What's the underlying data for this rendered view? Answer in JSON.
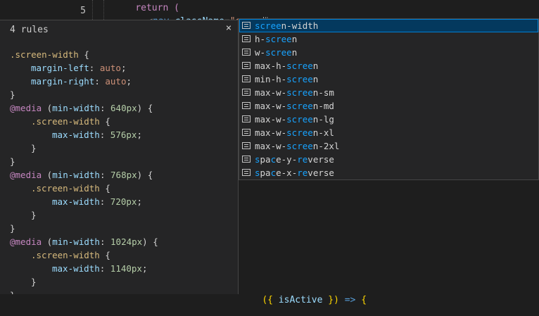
{
  "editor": {
    "line_number": "5",
    "line_prev_text": "return (",
    "tag_open": "<",
    "tag_name": "nav",
    "attr_name": "className",
    "attr_eq": "=",
    "attr_value": "\"scree",
    "tag_close": "\">",
    "bottom_code_open": "({",
    "bottom_code_var": " isActive ",
    "bottom_code_close": "})",
    "bottom_code_arrow": " => ",
    "bottom_code_brace": "{"
  },
  "hover": {
    "header": "4 rules",
    "close_symbol": "×",
    "lines": [
      {
        "type": "blank"
      },
      {
        "type": "selector",
        "indent": 0,
        "selector": ".screen-width",
        "tail": " {"
      },
      {
        "type": "decl",
        "indent": 1,
        "prop": "margin-left",
        "value": "auto"
      },
      {
        "type": "decl",
        "indent": 1,
        "prop": "margin-right",
        "value": "auto"
      },
      {
        "type": "close",
        "indent": 0
      },
      {
        "type": "media",
        "indent": 0,
        "at": "@media",
        "cond_open": " (",
        "prop": "min-width",
        "num": "640px",
        "cond_close": ") {"
      },
      {
        "type": "selector",
        "indent": 1,
        "selector": ".screen-width",
        "tail": " {"
      },
      {
        "type": "decl",
        "indent": 2,
        "prop": "max-width",
        "num": "576px"
      },
      {
        "type": "close",
        "indent": 1
      },
      {
        "type": "close",
        "indent": 0
      },
      {
        "type": "media",
        "indent": 0,
        "at": "@media",
        "cond_open": " (",
        "prop": "min-width",
        "num": "768px",
        "cond_close": ") {"
      },
      {
        "type": "selector",
        "indent": 1,
        "selector": ".screen-width",
        "tail": " {"
      },
      {
        "type": "decl",
        "indent": 2,
        "prop": "max-width",
        "num": "720px"
      },
      {
        "type": "close",
        "indent": 1
      },
      {
        "type": "close",
        "indent": 0
      },
      {
        "type": "media",
        "indent": 0,
        "at": "@media",
        "cond_open": " (",
        "prop": "min-width",
        "num": "1024px",
        "cond_close": ") {"
      },
      {
        "type": "selector",
        "indent": 1,
        "selector": ".screen-width",
        "tail": " {"
      },
      {
        "type": "decl",
        "indent": 2,
        "prop": "max-width",
        "num": "1140px"
      },
      {
        "type": "close",
        "indent": 1
      },
      {
        "type": "close",
        "indent": 0
      }
    ]
  },
  "suggestions": [
    {
      "pre": "",
      "match": "scree",
      "post": "n-width",
      "selected": true
    },
    {
      "pre": "h-",
      "match": "scree",
      "post": "n"
    },
    {
      "pre": "w-",
      "match": "scree",
      "post": "n"
    },
    {
      "pre": "max-h-",
      "match": "scree",
      "post": "n"
    },
    {
      "pre": "min-h-",
      "match": "scree",
      "post": "n"
    },
    {
      "pre": "max-w-",
      "match": "scree",
      "post": "n-sm"
    },
    {
      "pre": "max-w-",
      "match": "scree",
      "post": "n-md"
    },
    {
      "pre": "max-w-",
      "match": "scree",
      "post": "n-lg"
    },
    {
      "pre": "max-w-",
      "match": "scree",
      "post": "n-xl"
    },
    {
      "pre": "max-w-",
      "match": "scree",
      "post": "n-2xl"
    },
    {
      "parts": [
        [
          "s",
          1
        ],
        [
          "pa",
          0
        ],
        [
          "c",
          1
        ],
        [
          "e-y-",
          0
        ],
        [
          "re",
          1
        ],
        [
          "verse",
          0
        ]
      ]
    },
    {
      "parts": [
        [
          "s",
          1
        ],
        [
          "pa",
          0
        ],
        [
          "c",
          1
        ],
        [
          "e-x-",
          0
        ],
        [
          "re",
          1
        ],
        [
          "verse",
          0
        ]
      ]
    }
  ],
  "colors": {
    "background": "#1e1e1e",
    "widget_background": "#252526",
    "selected_row": "#04395e",
    "match_highlight": "#18a3ff"
  }
}
